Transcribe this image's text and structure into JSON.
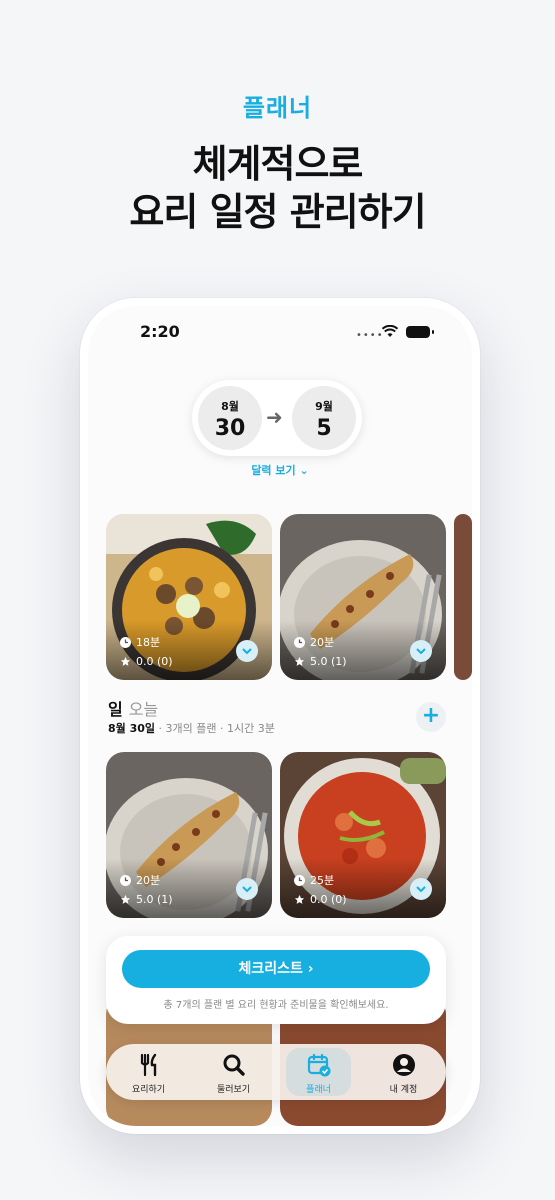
{
  "header": {
    "eyebrow": "플래너",
    "headline_line1": "체계적으로",
    "headline_line2": "요리 일정 관리하기"
  },
  "status_bar": {
    "time": "2:20"
  },
  "range": {
    "start_month": "8월",
    "start_day": "30",
    "end_month": "9월",
    "end_day": "5",
    "calendar_link": "달력 보기 ⌄"
  },
  "top_cards": [
    {
      "time": "18분",
      "rating": "0.0 (0)"
    },
    {
      "time": "20분",
      "rating": "5.0 (1)"
    }
  ],
  "day": {
    "label": "일",
    "today_label": "오늘",
    "date": "8월 30일",
    "plans": "3개의 플랜",
    "duration": "1시간 3분"
  },
  "day_cards": [
    {
      "time": "20분",
      "rating": "5.0 (1)"
    },
    {
      "time": "25분",
      "rating": "0.0 (0)"
    }
  ],
  "checklist": {
    "button_label": "체크리스트 ›",
    "hint": "총 7개의 플랜 별 요리 현황과 준비물을 확인해보세요."
  },
  "tabs": [
    {
      "label": "요리하기",
      "icon": "utensils-icon"
    },
    {
      "label": "둘러보기",
      "icon": "search-icon"
    },
    {
      "label": "플래너",
      "icon": "calendar-check-icon"
    },
    {
      "label": "내 계정",
      "icon": "user-icon"
    }
  ],
  "colors": {
    "accent": "#17aee0"
  }
}
